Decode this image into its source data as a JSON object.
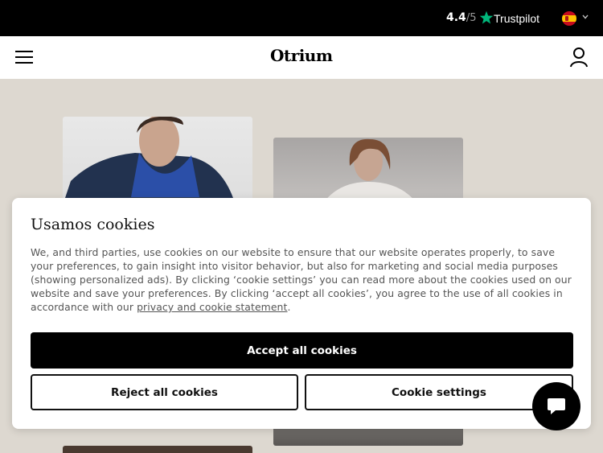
{
  "topbar": {
    "rating_value": "4.4",
    "rating_outof": "/5",
    "trustpilot_label": "Trustpilot",
    "star_icon": "trustpilot-star-icon",
    "flag_icon": "spain-flag-icon",
    "chevron_icon": "chevron-down-icon",
    "colors": {
      "background": "#000000",
      "star": "#00b67a"
    }
  },
  "header": {
    "logo_text": "Otrium",
    "menu_icon": "hamburger-menu-icon",
    "account_icon": "user-account-icon"
  },
  "cookie_modal": {
    "title": "Usamos cookies",
    "body_text": "We, and third parties, use cookies on our website to ensure that our website operates properly, to save your preferences, to gain insight into visitor behavior, but also for marketing and social media purposes (showing personalized ads). By clicking ‘cookie settings’ you can read more about the cookies used on our website and save your preferences. By clicking ‘accept all cookies’, you agree to the use of all cookies in accordance with our ",
    "privacy_link": "privacy and cookie statement",
    "body_end": ".",
    "accept_label": "Accept all cookies",
    "reject_label": "Reject all cookies",
    "settings_label": "Cookie settings"
  },
  "chat": {
    "icon": "chat-bubble-icon"
  },
  "colors": {
    "page_background": "#ddd8d0",
    "accent": "#000000"
  }
}
